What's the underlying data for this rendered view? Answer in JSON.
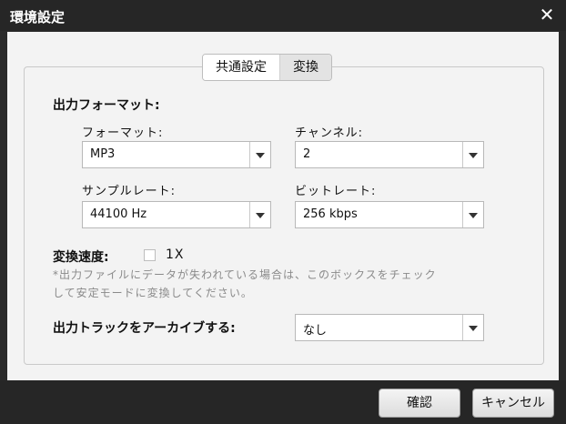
{
  "window": {
    "title": "環境設定"
  },
  "tabs": [
    {
      "label": "共通設定",
      "active": false
    },
    {
      "label": "変換",
      "active": true
    }
  ],
  "output_format": {
    "heading": "出力フォーマット:",
    "format": {
      "label": "フォーマット:",
      "value": "MP3"
    },
    "channel": {
      "label": "チャンネル:",
      "value": "2"
    },
    "sample_rate": {
      "label": "サンプルレート:",
      "value": "44100 Hz"
    },
    "bit_rate": {
      "label": "ビットレート:",
      "value": "256 kbps"
    }
  },
  "conversion_speed": {
    "label": "変換速度:",
    "option_label": "1X",
    "checked": false,
    "note_line1": "*出力ファイルにデータが失われている場合は、このボックスをチェック",
    "note_line2": "して安定モードに変換してください。"
  },
  "archive": {
    "label": "出力トラックをアーカイブする:",
    "value": "なし"
  },
  "buttons": {
    "ok": "確認",
    "cancel": "キャンセル"
  },
  "colors": {
    "titlebar": "#262626",
    "content_bg": "#f3f3f3",
    "border": "#c9c9c9"
  }
}
